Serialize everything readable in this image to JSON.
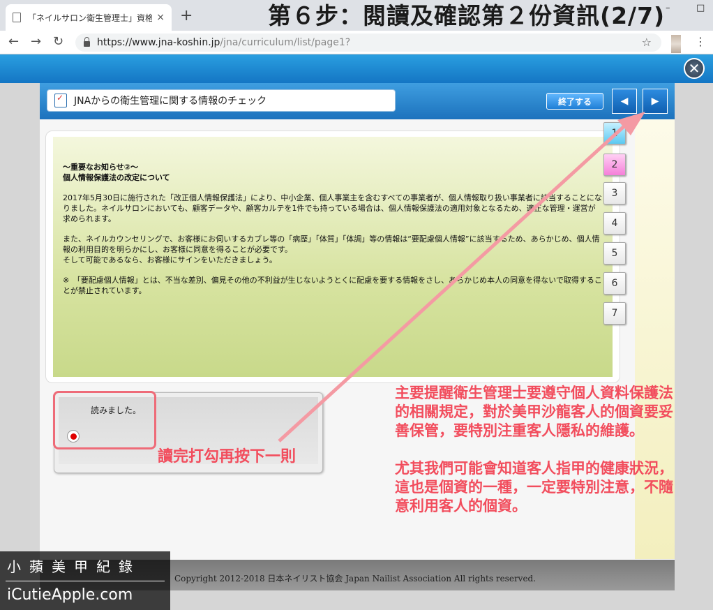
{
  "browser": {
    "tab_title": "「ネイルサロン衛生管理士」資格",
    "tab_close": "×",
    "new_tab": "+",
    "url_host": "https://www.jna-koshin.jp",
    "url_path": "/jna/curriculum/list/page1?",
    "back": "←",
    "forward": "→",
    "reload": "↻",
    "star": "☆",
    "menu": "⋮",
    "min": "–",
    "max": "□"
  },
  "step_title": "第６步：閱讀及確認第２份資訊(2/7)",
  "modal": {
    "title": "JNAからの衛生管理に関する情報のチェック",
    "end_button": "終了する",
    "prev": "◀",
    "next": "▶",
    "close": "✕"
  },
  "notice": {
    "heading1": "～重要なお知らせ②～",
    "heading2": "個人情報保護法の改定について",
    "para1": "2017年5月30日に施行された「改正個人情報保護法」により、中小企業、個人事業主を含むすべての事業者が、個人情報取り扱い事業者に該当することになりました。ネイルサロンにおいても、顧客データや、顧客カルテを1件でも持っている場合は、個人情報保護法の適用対象となるため、適正な管理・運営が求められます。",
    "para2": "また、ネイルカウンセリングで、お客様にお伺いするカブレ等の「病歴」「体質」「体調」等の情報は“要配慮個人情報”に該当するため、あらかじめ、個人情報の利用目的を明らかにし、お客様に同意を得ることが必要です。",
    "para3": "そして可能であるなら、お客様にサインをいただきましょう。",
    "para4": "※　「要配慮個人情報」とは、不当な差別、偏見その他の不利益が生じないようとくに配慮を要する情報をさし、あらかじめ本人の同意を得ないで取得することが禁止されています。"
  },
  "pages": [
    "1",
    "2",
    "3",
    "4",
    "5",
    "6",
    "7"
  ],
  "read_label": "読みました。",
  "annotations": {
    "read_hint": "讀完打勾再按下一則",
    "note1": "主要提醒衛生管理士要遵守個人資料保護法的相關規定，對於美甲沙龍客人的個資要妥善保管，要特別注重客人隱私的維護。",
    "note2": "尤其我們可能會知道客人指甲的健康狀況，這也是個資的一種，一定要特別注意，不隨意利用客人的個資。"
  },
  "copyright": "Copyright 2012-2018 日本ネイリスト協会 Japan Nailist Association All rights reserved.",
  "watermark": {
    "cn": "小蘋美甲紀錄",
    "en": "iCutieApple.com"
  },
  "colors": {
    "accent_blue": "#1c72bd",
    "annotation_red": "#f24d5d",
    "notice_green": "#d7e3a0"
  }
}
